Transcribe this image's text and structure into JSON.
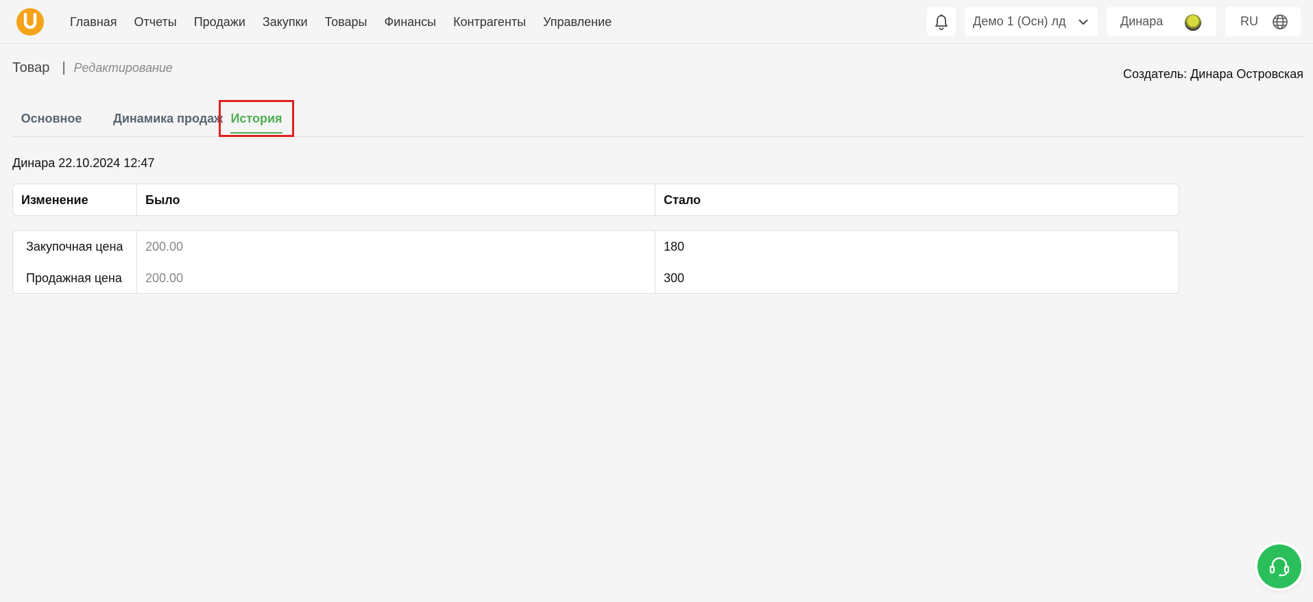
{
  "header": {
    "logo_letter": "U",
    "nav": [
      "Главная",
      "Отчеты",
      "Продажи",
      "Закупки",
      "Товары",
      "Финансы",
      "Контрагенты",
      "Управление"
    ],
    "company": "Демо 1 (Осн) лд",
    "user": "Динара",
    "lang": "RU"
  },
  "page": {
    "title": "Товар",
    "separator": "|",
    "subtitle": "Редактирование",
    "creator": "Создатель: Динара Островская"
  },
  "tabs": [
    {
      "label": "Основное",
      "active": false
    },
    {
      "label": "Динамика продаж",
      "active": false
    },
    {
      "label": "История",
      "active": true
    }
  ],
  "history": {
    "entry_header": "Динара 22.10.2024 12:47",
    "columns": [
      "Изменение",
      "Было",
      "Стало"
    ],
    "rows": [
      {
        "field": "Закупочная цена",
        "was": "200.00",
        "became": "180"
      },
      {
        "field": "Продажная цена",
        "was": "200.00",
        "became": "300"
      }
    ]
  },
  "colors": {
    "accent_green": "#4caf50",
    "logo_orange": "#f5a31a",
    "highlight_red": "#e02020",
    "support_green": "#2bbf5b"
  },
  "icons": [
    "bell-icon",
    "chevron-down-icon",
    "avatar",
    "globe-icon",
    "headset-icon"
  ]
}
